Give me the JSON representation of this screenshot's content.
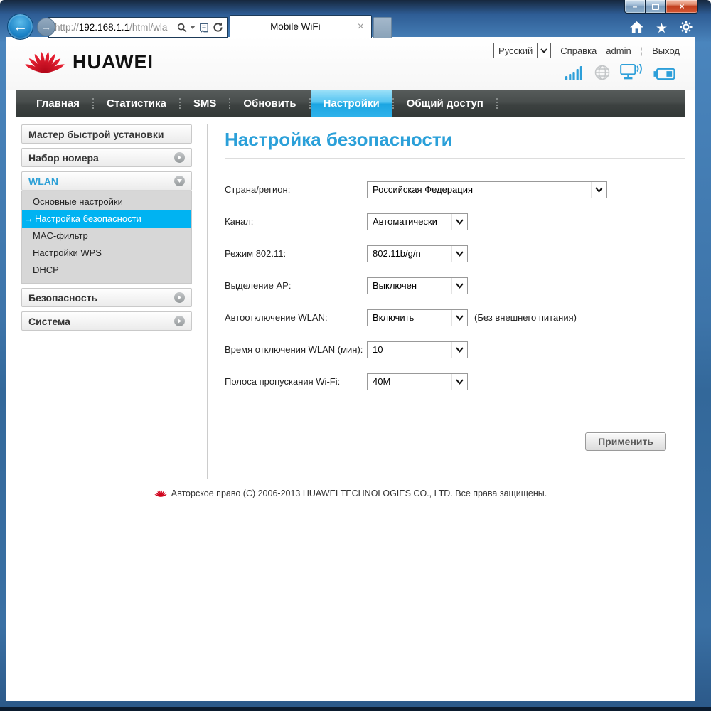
{
  "browser": {
    "url": {
      "prefix": "http://",
      "host": "192.168.1.1",
      "path": "/html/wla"
    },
    "tab_title": "Mobile WiFi"
  },
  "icons": {
    "back": "←",
    "forward": "→",
    "minimize": "–",
    "close": "×",
    "close_tab": "×",
    "star": "★",
    "active_item_arrow": "→"
  },
  "header": {
    "logo_text": "HUAWEI",
    "language_selected": "Русский",
    "links": {
      "help": "Справка",
      "user": "admin",
      "logout": "Выход"
    }
  },
  "nav": {
    "tabs": [
      {
        "label": "Главная",
        "active": false
      },
      {
        "label": "Статистика",
        "active": false
      },
      {
        "label": "SMS",
        "active": false
      },
      {
        "label": "Обновить",
        "active": false
      },
      {
        "label": "Настройки",
        "active": true
      },
      {
        "label": "Общий доступ",
        "active": false
      }
    ]
  },
  "sidebar": {
    "items": [
      {
        "label": "Мастер быстрой установки",
        "type": "header"
      },
      {
        "label": "Набор номера",
        "type": "header",
        "collapsed": true
      },
      {
        "label": "WLAN",
        "type": "header",
        "expanded": true,
        "children": [
          {
            "label": "Основные настройки",
            "active": false
          },
          {
            "label": "Настройка безопасности",
            "active": true
          },
          {
            "label": "MAC-фильтр",
            "active": false
          },
          {
            "label": "Настройки WPS",
            "active": false
          },
          {
            "label": "DHCP",
            "active": false
          }
        ]
      },
      {
        "label": "Безопасность",
        "type": "header",
        "collapsed": true
      },
      {
        "label": "Система",
        "type": "header",
        "collapsed": true
      }
    ]
  },
  "main": {
    "title": "Настройка безопасности",
    "fields": [
      {
        "label": "Страна/регион:",
        "value": "Российская Федерация",
        "wide": true
      },
      {
        "label": "Канал:",
        "value": "Автоматически"
      },
      {
        "label": "Режим 802.11:",
        "value": "802.11b/g/n"
      },
      {
        "label": "Выделение AP:",
        "value": "Выключен"
      },
      {
        "label": "Автоотключение WLAN:",
        "value": "Включить",
        "note": "(Без внешнего питания)"
      },
      {
        "label": "Время отключения WLAN (мин):",
        "value": "10"
      },
      {
        "label": "Полоса пропускания Wi-Fi:",
        "value": "40M"
      }
    ],
    "apply_label": "Применить"
  },
  "footer": {
    "copyright": "Авторское право (C) 2006-2013 HUAWEI TECHNOLOGIES CO., LTD. Все права защищены."
  },
  "colors": {
    "accent_blue": "#2ba0d9",
    "active_item_cyan": "#00b3f2",
    "nav_dark": "#454948",
    "tab_active_blue": "#2eb2ea",
    "huawei_red": "#d0021b"
  }
}
